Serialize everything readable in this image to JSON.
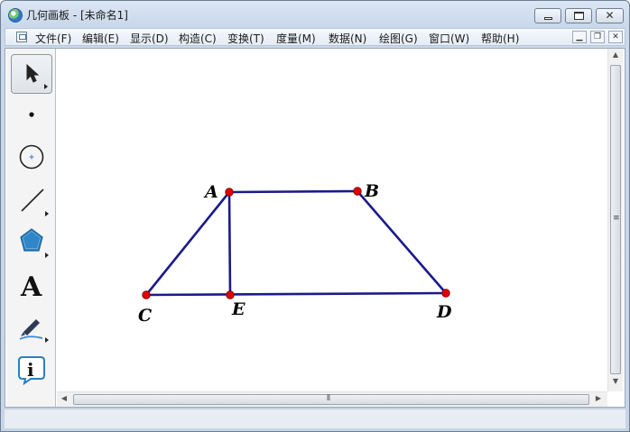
{
  "window": {
    "title": "几何画板 - [未命名1]",
    "buttons": {
      "minimize": "minimize",
      "maximize": "maximize",
      "close": "close"
    }
  },
  "menubar": {
    "items": [
      "文件(F)",
      "编辑(E)",
      "显示(D)",
      "构造(C)",
      "变换(T)",
      "度量(M)",
      "数据(N)",
      "绘图(G)",
      "窗口(W)",
      "帮助(H)"
    ]
  },
  "toolbox": {
    "tools": [
      {
        "name": "selection-arrow-tool",
        "selected": true
      },
      {
        "name": "point-tool"
      },
      {
        "name": "compass-tool"
      },
      {
        "name": "straightedge-tool"
      },
      {
        "name": "polygon-tool"
      },
      {
        "name": "text-tool",
        "glyph": "A"
      },
      {
        "name": "marker-tool"
      },
      {
        "name": "information-tool"
      }
    ]
  },
  "figure": {
    "points": [
      {
        "label": "A"
      },
      {
        "label": "B"
      },
      {
        "label": "C"
      },
      {
        "label": "D"
      },
      {
        "label": "E"
      }
    ],
    "segments": [
      [
        "A",
        "B"
      ],
      [
        "A",
        "C"
      ],
      [
        "B",
        "D"
      ],
      [
        "C",
        "D"
      ],
      [
        "A",
        "E"
      ]
    ],
    "colors": {
      "segment": "#1a1a8c",
      "point": "#e00000",
      "point_outline": "#7a0000"
    }
  }
}
